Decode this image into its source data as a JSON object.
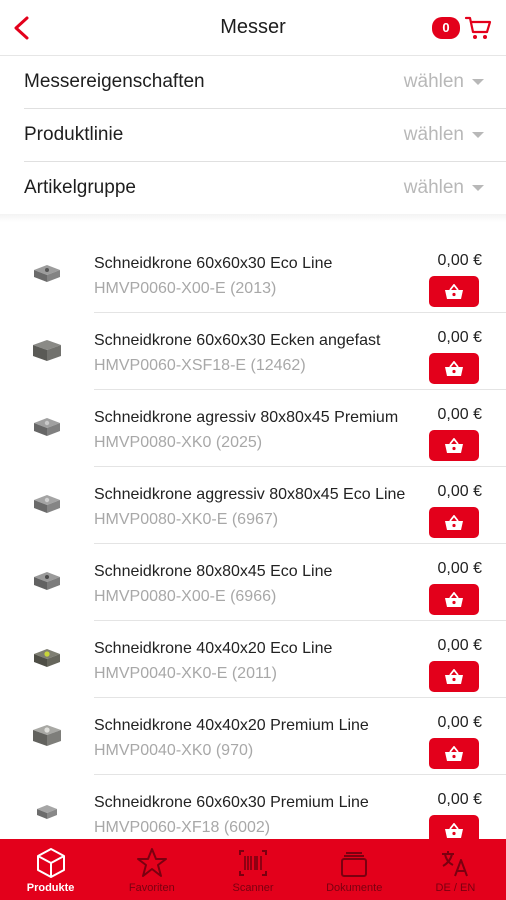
{
  "header": {
    "title": "Messer",
    "cart_count": "0"
  },
  "filters": [
    {
      "label": "Messereigenschaften",
      "value": "wählen"
    },
    {
      "label": "Produktlinie",
      "value": "wählen"
    },
    {
      "label": "Artikelgruppe",
      "value": "wählen"
    }
  ],
  "products": [
    {
      "name": "Schneidkrone 60x60x30 Eco Line",
      "code": "HMVP0060-X00-E (2013)",
      "price": "0,00 €"
    },
    {
      "name": "Schneidkrone 60x60x30 Ecken angefast",
      "code": "HMVP0060-XSF18-E (12462)",
      "price": "0,00 €"
    },
    {
      "name": "Schneidkrone agressiv 80x80x45 Premium",
      "code": "HMVP0080-XK0 (2025)",
      "price": "0,00 €"
    },
    {
      "name": "Schneidkrone aggressiv 80x80x45 Eco Line",
      "code": "HMVP0080-XK0-E (6967)",
      "price": "0,00 €"
    },
    {
      "name": "Schneidkrone 80x80x45 Eco Line",
      "code": "HMVP0080-X00-E (6966)",
      "price": "0,00 €"
    },
    {
      "name": "Schneidkrone 40x40x20 Eco Line",
      "code": "HMVP0040-XK0-E (2011)",
      "price": "0,00 €"
    },
    {
      "name": "Schneidkrone 40x40x20 Premium Line",
      "code": "HMVP0040-XK0 (970)",
      "price": "0,00 €"
    },
    {
      "name": "Schneidkrone 60x60x30 Premium Line",
      "code": "HMVP0060-XF18 (6002)",
      "price": "0,00 €"
    }
  ],
  "tabbar": [
    {
      "label": "Produkte",
      "icon": "cube-icon",
      "active": true
    },
    {
      "label": "Favoriten",
      "icon": "star-icon",
      "active": false
    },
    {
      "label": "Scanner",
      "icon": "barcode-icon",
      "active": false
    },
    {
      "label": "Dokumente",
      "icon": "documents-icon",
      "active": false
    },
    {
      "label": "DE / EN",
      "icon": "translate-icon",
      "active": false
    }
  ],
  "colors": {
    "accent": "#e3001b",
    "muted_text": "#a8a8a8"
  }
}
